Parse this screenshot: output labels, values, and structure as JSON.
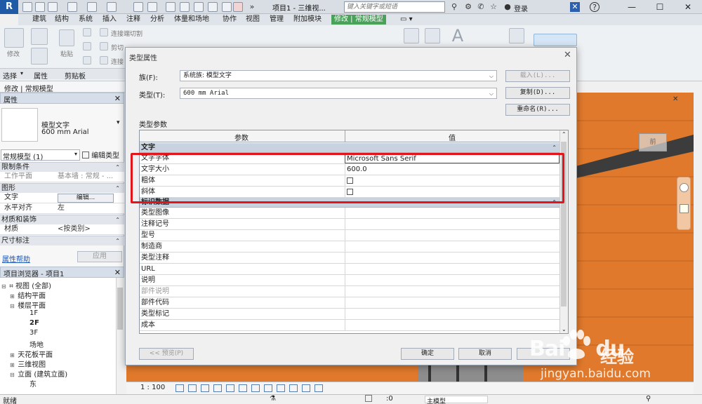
{
  "titlebar": {
    "title": "项目1 - 三维视...",
    "search_placeholder": "键入关键字或短语",
    "login": "登录",
    "help": "?"
  },
  "ribbon_tabs": [
    "建筑",
    "结构",
    "系统",
    "插入",
    "注释",
    "分析",
    "体量和场地",
    "协作",
    "视图",
    "管理",
    "附加模块",
    "修改 | 常规模型"
  ],
  "ribbon": {
    "modify": "修改",
    "paste": "粘贴",
    "connect_cut": "连接端切割",
    "cut": "剪切",
    "join": "连接",
    "panel_select": "选择",
    "panel_props": "属性",
    "panel_clipboard": "剪贴板"
  },
  "context_label": "修改 | 常规模型",
  "properties": {
    "header": "属性",
    "type_name": "模型文字",
    "type_size": "600 mm Arial",
    "instance_selector": "常规模型 (1)",
    "edit_type": "编辑类型",
    "sections": {
      "constraints": "限制条件",
      "graphics": "图形",
      "materials": "材质和装饰",
      "dimensions": "尺寸标注"
    },
    "rows": {
      "work_plane_label": "工作平面",
      "work_plane_value": "基本墙 : 常规 - ...",
      "text_label": "文字",
      "text_button": "编辑...",
      "halign_label": "水平对齐",
      "halign_value": "左",
      "material_label": "材质",
      "material_value": "<按类别>"
    },
    "help": "属性帮助",
    "apply": "应用"
  },
  "browser": {
    "header": "项目浏览器 - 项目1",
    "items": [
      "视图 (全部)",
      "结构平面",
      "楼层平面",
      "1F",
      "2F",
      "3F",
      "场地",
      "天花板平面",
      "三维视图",
      "立面 (建筑立面)",
      "东"
    ]
  },
  "view": {
    "scale": "1 : 100",
    "cube_label": "前"
  },
  "status": {
    "text": "就绪",
    "zero": ":0",
    "model": "主模型"
  },
  "dialog": {
    "title": "类型属性",
    "family_label": "族(F):",
    "family_value": "系统族: 模型文字",
    "type_label": "类型(T):",
    "type_value": "600 mm Arial",
    "load_btn": "载入(L)...",
    "copy_btn": "复制(D)...",
    "rename_btn": "重命名(R)...",
    "params_label": "类型参数",
    "col_param": "参数",
    "col_value": "值",
    "section_text": "文字",
    "section_identity": "标识数据",
    "text_rows": [
      {
        "k": "文字字体",
        "v": "Microsoft Sans Serif"
      },
      {
        "k": "文字大小",
        "v": "600.0"
      },
      {
        "k": "粗体",
        "v": ""
      },
      {
        "k": "斜体",
        "v": ""
      }
    ],
    "identity_rows": [
      "类型图像",
      "注释记号",
      "型号",
      "制造商",
      "类型注释",
      "URL",
      "说明",
      "部件说明",
      "部件代码",
      "类型标记",
      "成本"
    ],
    "preview_btn": "<< 预览(P)",
    "ok_btn": "确定",
    "cancel_btn": "取消"
  },
  "watermark": {
    "logo": "Bai",
    "logo2": "du",
    "brand": "经验",
    "url": "jingyan.baidu.com"
  },
  "colors": {
    "active_tab": "#4aa15a",
    "viewport": "#e0792b",
    "highlight": "#e3151a",
    "section_bg": "#c9d3e0"
  }
}
